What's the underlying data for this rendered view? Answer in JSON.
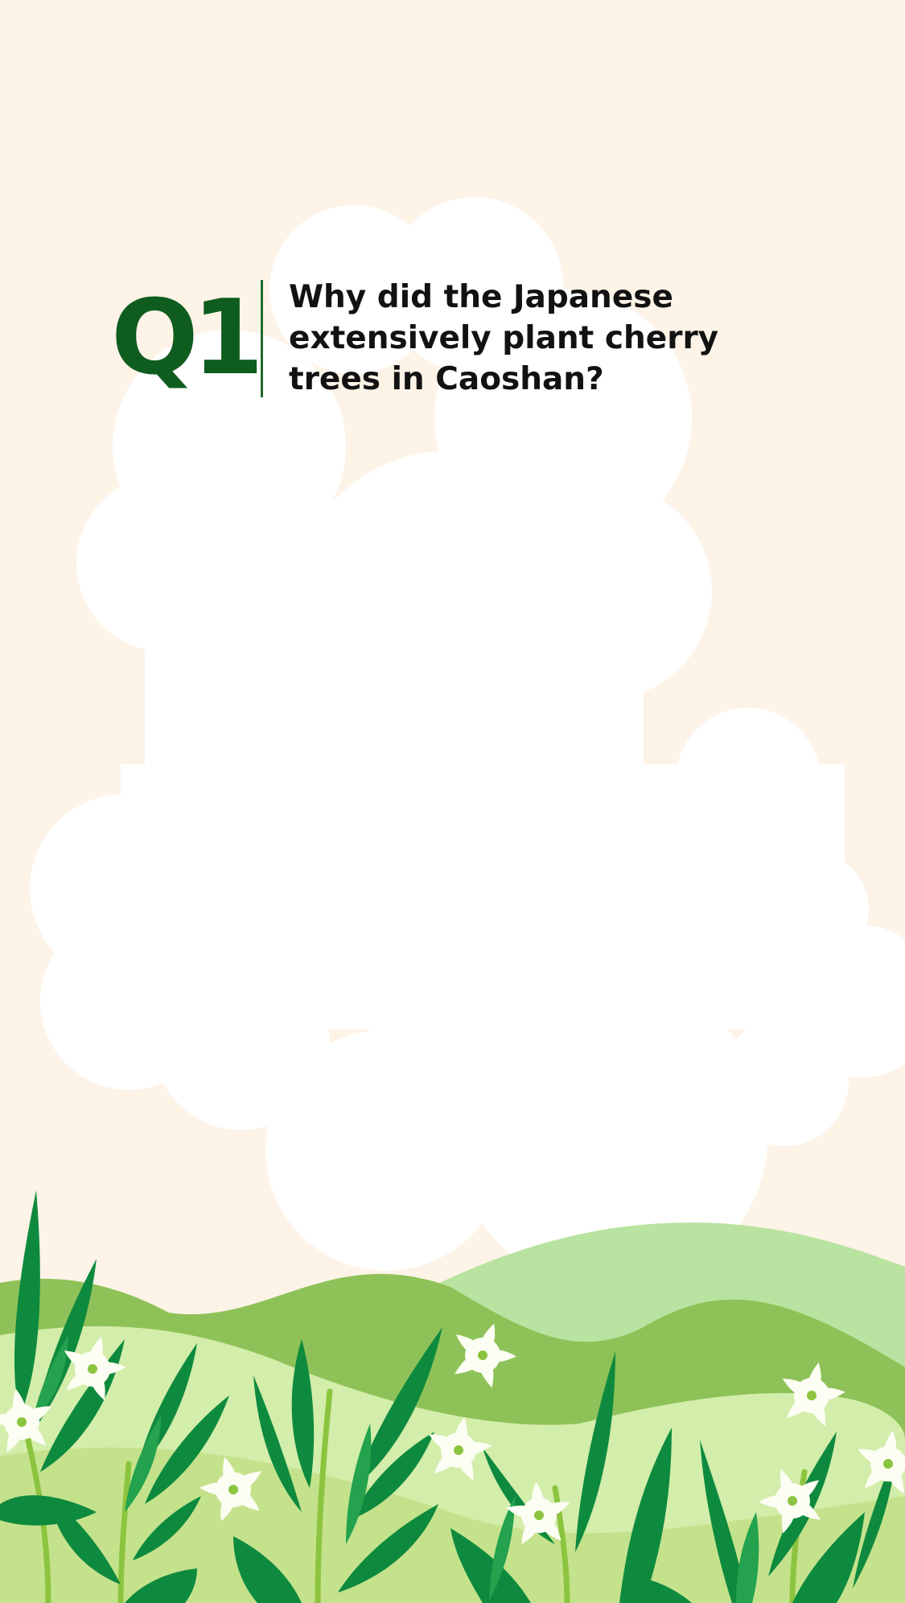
{
  "question": {
    "number": "Q1",
    "lines": [
      "Why did the Japanese",
      "extensively plant cherry",
      "trees in Caoshan?"
    ]
  },
  "colors": {
    "background": "#fdf3e7",
    "cloud": "#ffffff",
    "q_number": "#0f5c1f",
    "divider": "#1e6b2a",
    "hill_light": "#b9e3a0",
    "hill_mid": "#8ec258",
    "hill_front": "#d3edaa",
    "leaf_dark": "#0e8a3e",
    "leaf_mid": "#24a24e",
    "flower": "#fcfdf3",
    "flower_center": "#8cc43f"
  },
  "icons": [
    "cloud-shape",
    "hill-layers",
    "leaf-cluster",
    "flower-icon"
  ]
}
